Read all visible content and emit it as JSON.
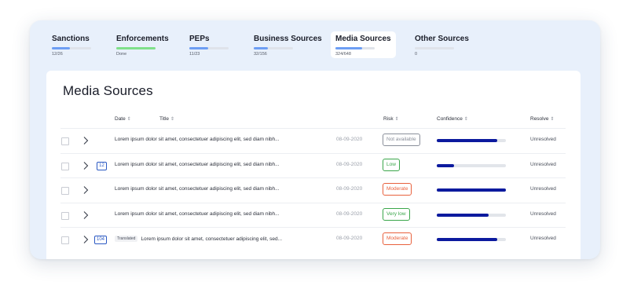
{
  "tabs": [
    {
      "label": "Sanctions",
      "count": "12/26",
      "progress": 0.46,
      "color": "#6d9ef4"
    },
    {
      "label": "Enforcements",
      "count": "Done",
      "progress": 1.0,
      "color": "#7fe08a"
    },
    {
      "label": "PEPs",
      "count": "11/23",
      "progress": 0.48,
      "color": "#6d9ef4"
    },
    {
      "label": "Business Sources",
      "count": "32/156",
      "progress": 0.35,
      "color": "#6d9ef4"
    },
    {
      "label": "Media Sources",
      "count": "324/648",
      "progress": 0.68,
      "color": "#6d9ef4",
      "active": true
    },
    {
      "label": "Other Sources",
      "count": "0",
      "progress": 0,
      "color": "#6d9ef4"
    }
  ],
  "page_title": "Media Sources",
  "columns": {
    "date": "Date",
    "title": "Title",
    "risk": "Risk",
    "confidence": "Confidence",
    "resolve": "Resolve",
    "sort_icon": "⇕"
  },
  "rows": [
    {
      "count": "",
      "translated": "",
      "title": "Lorem ipsum dolor sit amet, consectetuer adipiscing elit, sed diam  nibh...",
      "date": "08-09-2020",
      "risk": "Not available",
      "risk_color": "#8a8f9a",
      "confidence": 0.88,
      "resolve": "Unresolved"
    },
    {
      "count": "12",
      "translated": "",
      "title": "Lorem ipsum dolor sit amet, consectetuer adipiscing elit, sed diam  nibh...",
      "date": "08-09-2020",
      "risk": "Low",
      "risk_color": "#3aa64a",
      "confidence": 0.25,
      "resolve": "Unresolved"
    },
    {
      "count": "",
      "translated": "",
      "title": "Lorem ipsum dolor sit amet, consectetuer adipiscing elit, sed diam  nibh...",
      "date": "08-09-2020",
      "risk": "Moderate",
      "risk_color": "#e8613d",
      "confidence": 1.0,
      "resolve": "Unresolved"
    },
    {
      "count": "",
      "translated": "",
      "title": "Lorem ipsum dolor sit amet, consectetuer adipiscing elit, sed diam  nibh...",
      "date": "08-09-2020",
      "risk": "Very low",
      "risk_color": "#3aa64a",
      "confidence": 0.75,
      "resolve": "Unresolved"
    },
    {
      "count": "104",
      "translated": "Translated",
      "title": "Lorem ipsum dolor sit amet, consectetuer adipiscing elit, sed...",
      "date": "08-09-2020",
      "risk": "Moderate",
      "risk_color": "#e8613d",
      "confidence": 0.88,
      "resolve": "Unresolved"
    }
  ]
}
